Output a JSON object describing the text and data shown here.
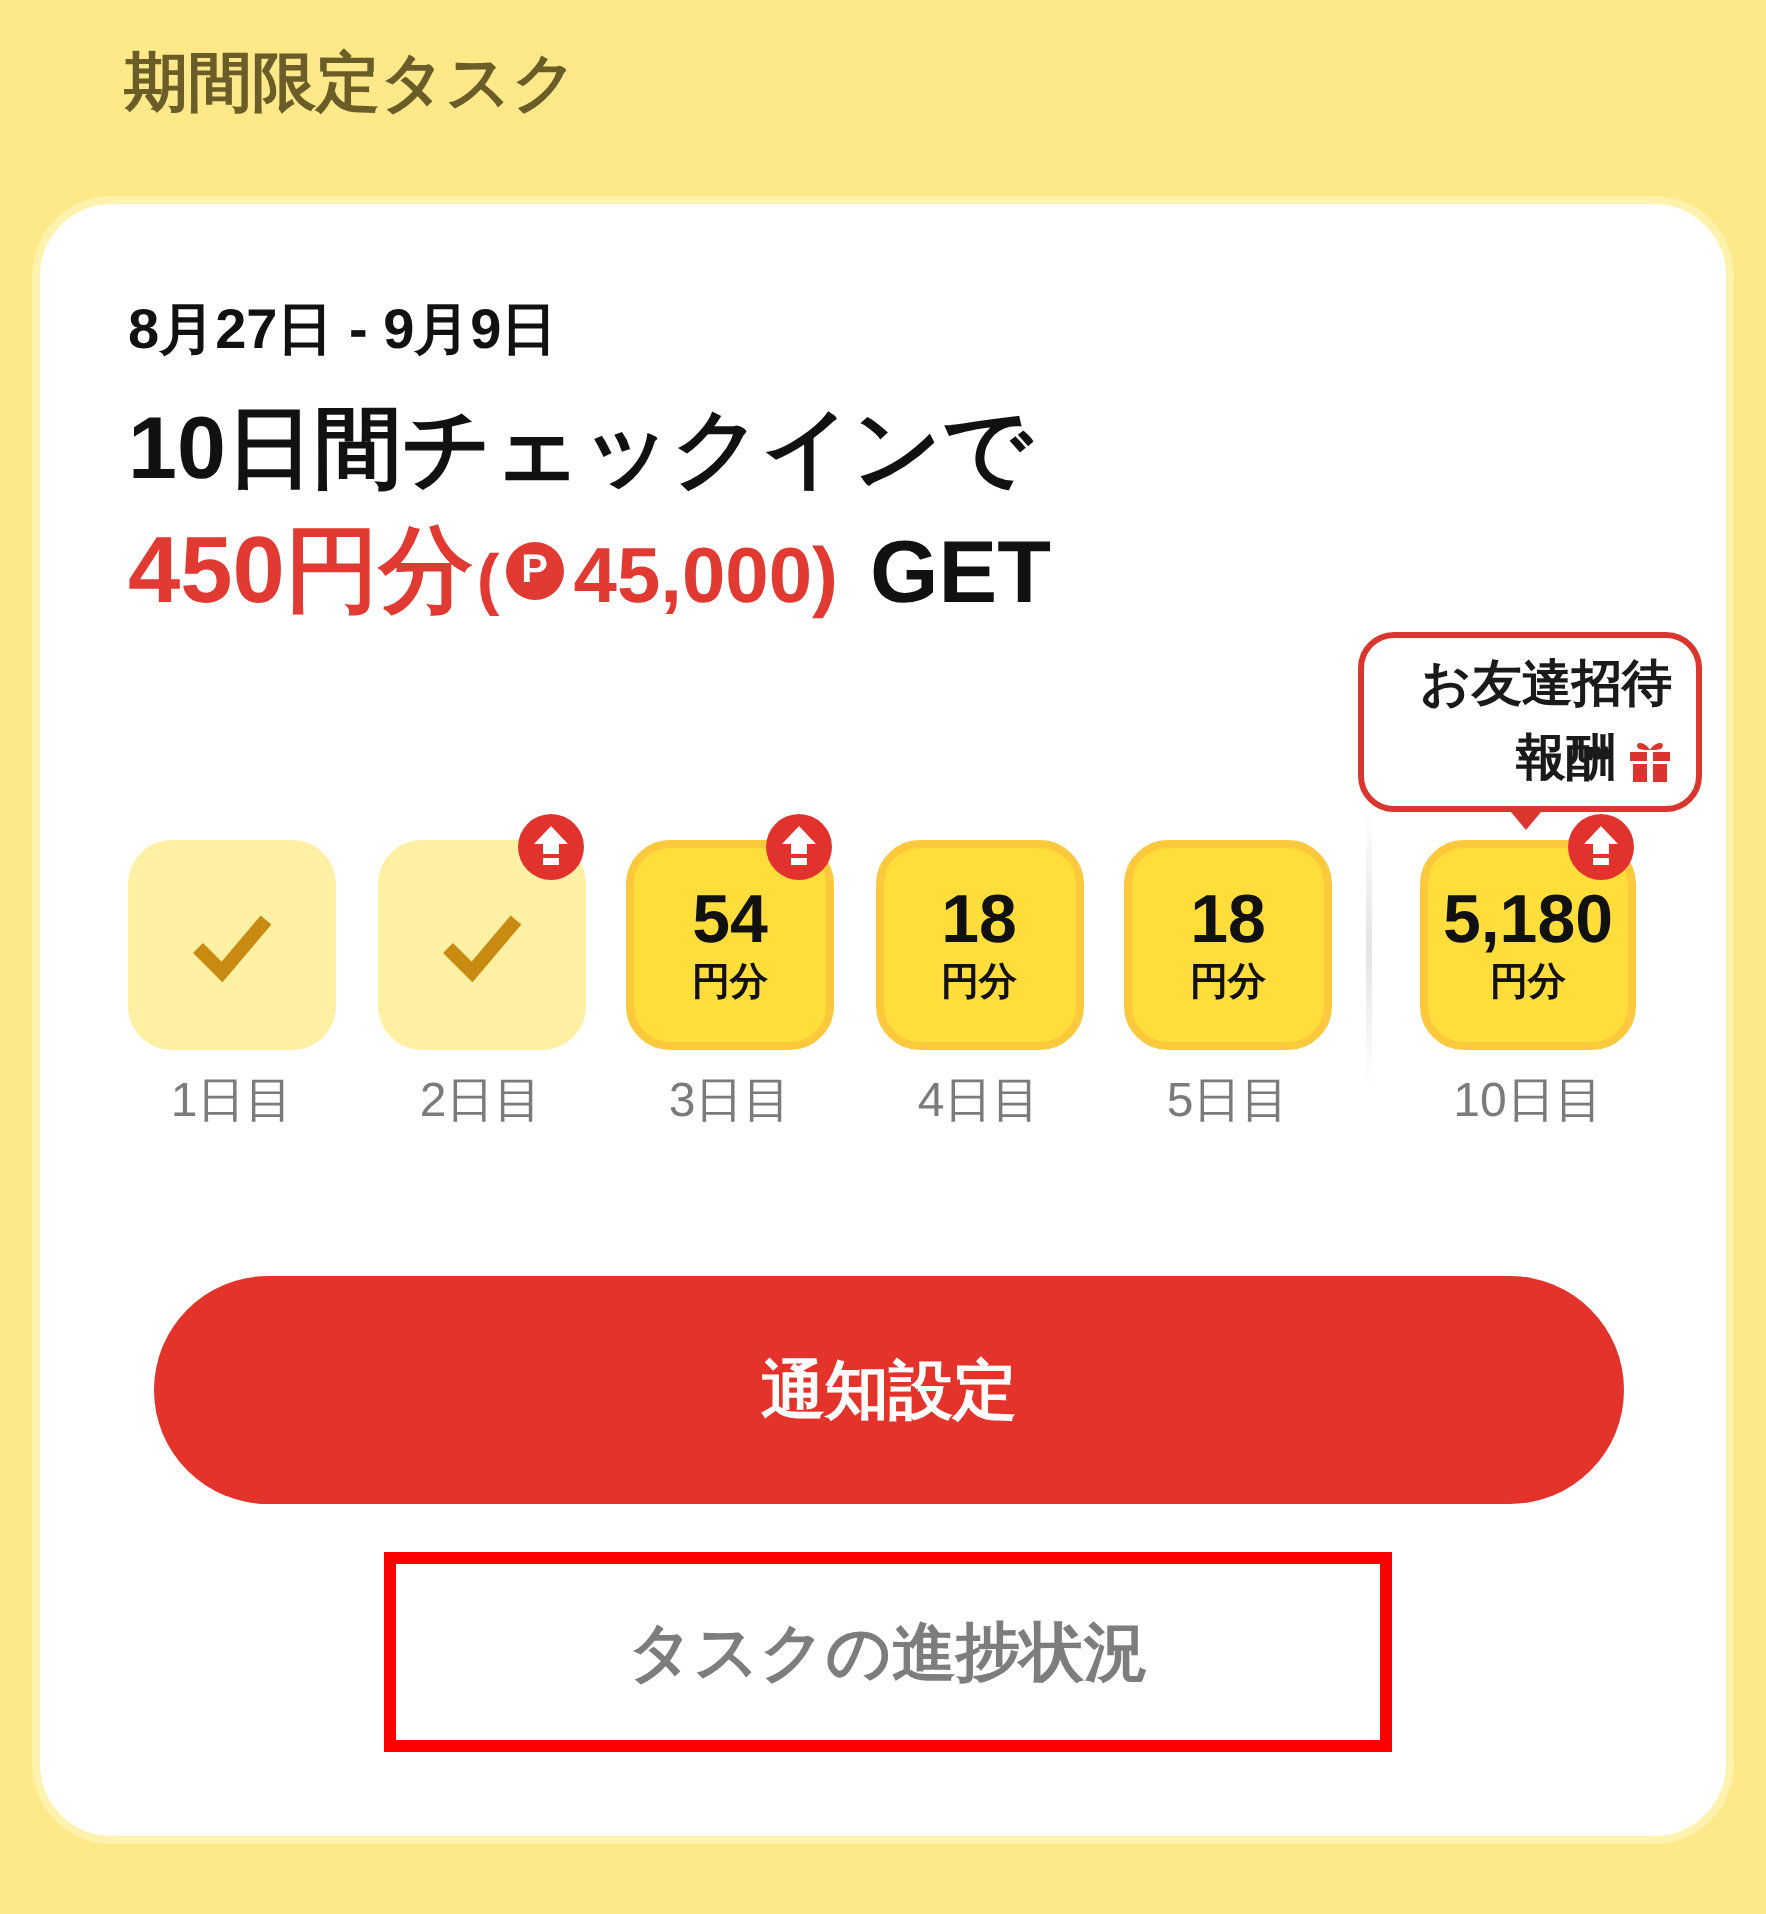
{
  "section_title": "期間限定タスク",
  "campaign": {
    "period": "8月27日 - 9月9日",
    "headline": "10日間チェックインで",
    "reward_amount": "450円分",
    "points_open": "(",
    "points_mark": "P",
    "points_value": "45,000)",
    "reward_suffix": "GET"
  },
  "days": [
    {
      "label": "1日目",
      "checked": true,
      "boosted": false
    },
    {
      "label": "2日目",
      "checked": true,
      "boosted": true
    },
    {
      "label": "3日目",
      "checked": false,
      "amount": "54",
      "unit": "円分",
      "boosted": true
    },
    {
      "label": "4日目",
      "checked": false,
      "amount": "18",
      "unit": "円分",
      "boosted": false
    },
    {
      "label": "5日目",
      "checked": false,
      "amount": "18",
      "unit": "円分",
      "boosted": false
    }
  ],
  "goal_day": {
    "label": "10日目",
    "checked": false,
    "amount": "5,180",
    "unit": "円分",
    "boosted": true,
    "tooltip": {
      "lines": [
        "お友達招待",
        "報酬"
      ]
    }
  },
  "notify_button": {
    "label": "通知設定"
  },
  "progress_link": {
    "label": "タスクの進捗状況",
    "highlighted": true
  }
}
